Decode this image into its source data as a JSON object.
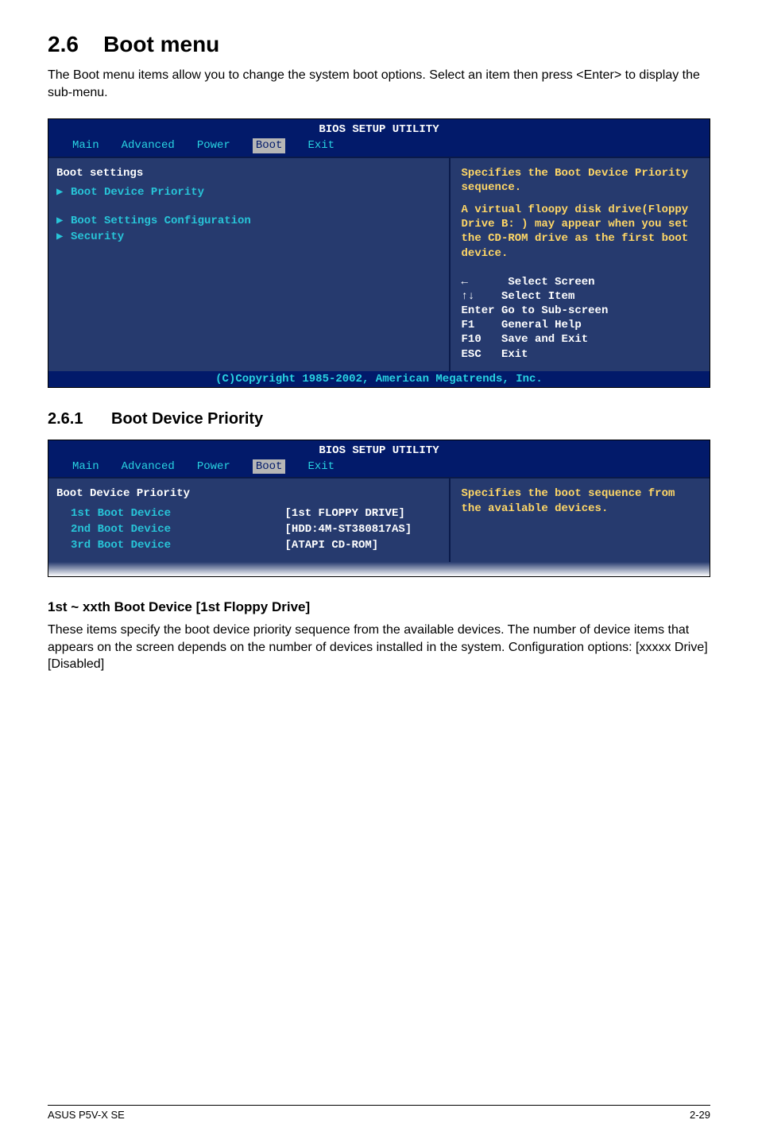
{
  "heading": {
    "number": "2.6",
    "title": "Boot menu"
  },
  "intro": "The Boot menu items allow you to change the system boot options. Select an item then press <Enter> to display the sub-menu.",
  "bios1": {
    "utility_title": "BIOS SETUP UTILITY",
    "tabs": [
      "Main",
      "Advanced",
      "Power",
      "Boot",
      "Exit"
    ],
    "active_tab": "Boot",
    "left": {
      "header": "Boot settings",
      "items": [
        "Boot Device Priority",
        "Boot Settings Configuration",
        "Security"
      ]
    },
    "right": {
      "desc1": "Specifies the Boot Device Priority sequence.",
      "desc2": "A virtual floopy disk drive(Floppy Drive B: ) may appear when you set the CD-ROM drive as the first boot device.",
      "legend": [
        "←      Select Screen",
        "↑↓    Select Item",
        "Enter Go to Sub-screen",
        "F1    General Help",
        "F10   Save and Exit",
        "ESC   Exit"
      ]
    },
    "copyright": "(C)Copyright 1985-2002, American Megatrends, Inc."
  },
  "sub": {
    "number": "2.6.1",
    "title": "Boot Device Priority"
  },
  "bios2": {
    "utility_title": "BIOS SETUP UTILITY",
    "tabs": [
      "Main",
      "Advanced",
      "Power",
      "Boot",
      "Exit"
    ],
    "active_tab": "Boot",
    "left": {
      "header": "Boot Device Priority",
      "rows": [
        {
          "label": "1st Boot Device",
          "value": "[1st FLOPPY DRIVE]"
        },
        {
          "label": "2nd Boot Device",
          "value": "[HDD:4M-ST380817AS]"
        },
        {
          "label": "3rd Boot Device",
          "value": "[ATAPI CD-ROM]"
        }
      ]
    },
    "right": {
      "desc": "Specifies the boot sequence from the available devices."
    }
  },
  "h3": "1st ~ xxth Boot Device [1st Floppy Drive]",
  "para2": "These items specify the boot device priority sequence from the available devices. The number of device items that appears on the screen depends on the number of devices installed in the system. Configuration options: [xxxxx Drive] [Disabled]",
  "footer": {
    "left": "ASUS P5V-X SE",
    "right": "2-29"
  }
}
